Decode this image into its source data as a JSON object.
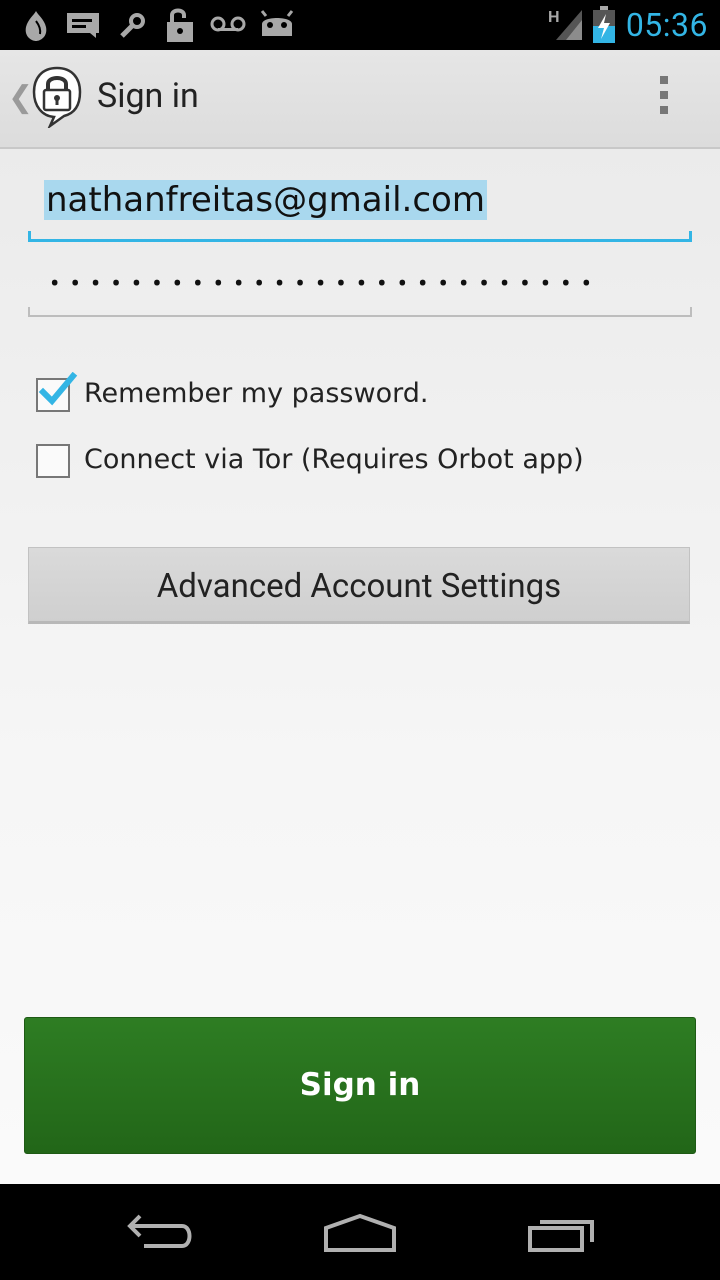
{
  "status_bar": {
    "time": "05:36",
    "network_type": "H",
    "icons": [
      "orbot-onion-icon",
      "message-icon",
      "tool-icon",
      "unlock-icon",
      "voicemail-icon",
      "android-debug-icon",
      "signal-icon",
      "battery-charging-icon"
    ],
    "accent_color": "#33b5e5"
  },
  "action_bar": {
    "title": "Sign in",
    "icons": [
      "chevron-left-icon",
      "lock-bubble-logo-icon",
      "overflow-menu-icon"
    ]
  },
  "form": {
    "email_value": "nathanfreitas@gmail.com",
    "password_mask": "•••••••••••••••••••••••••••",
    "remember_label": "Remember my password.",
    "remember_checked": true,
    "tor_label": "Connect via Tor (Requires Orbot app)",
    "tor_checked": false,
    "advanced_label": "Advanced Account Settings",
    "signin_label": "Sign in",
    "signin_color": "#2a7220"
  },
  "nav_bar": {
    "icons": [
      "back-icon",
      "home-icon",
      "recents-icon"
    ]
  }
}
